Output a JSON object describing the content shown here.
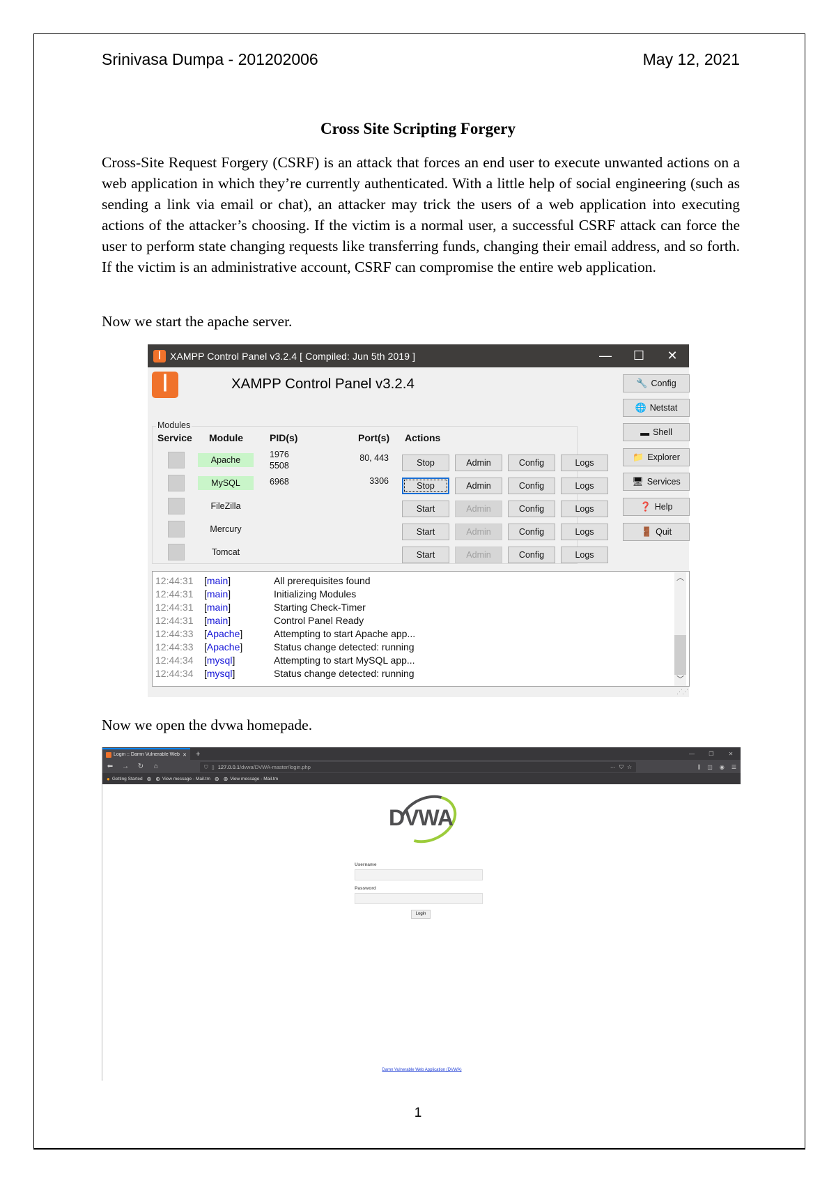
{
  "header": {
    "author": "Srinivasa Dumpa - 201202006",
    "date": "May 12, 2021"
  },
  "title": "Cross Site Scripting Forgery",
  "paragraphs": {
    "intro": "Cross-Site Request Forgery (CSRF) is an attack that forces an end user to execute unwanted actions on a web application in which they’re currently authenticated. With a little help of social engineering (such as sending a link via email or chat), an attacker may trick the users of a web application into executing actions of the attacker’s choosing. If the victim is a normal user, a successful CSRF attack can force the user to perform state changing requests like transferring funds, changing their email address, and so forth. If the victim is an administrative account, CSRF can compromise the entire web application.",
    "start_server": "Now we start the apache server.",
    "open_dvwa": "Now we open the dvwa homepade."
  },
  "page_number": "1",
  "xampp": {
    "window_title": "XAMPP Control Panel v3.2.4   [ Compiled: Jun 5th 2019 ]",
    "logo_glyph": "ꟾ",
    "heading": "XAMPP Control Panel v3.2.4",
    "modules_label": "Modules",
    "columns": {
      "service": "Service",
      "module": "Module",
      "pids": "PID(s)",
      "ports": "Port(s)",
      "actions": "Actions"
    },
    "modules": [
      {
        "name": "Apache",
        "running": true,
        "pids": [
          "1976",
          "5508"
        ],
        "ports": "80, 443",
        "action": "Stop",
        "admin": "Admin",
        "admin_enabled": true,
        "config": "Config",
        "logs": "Logs"
      },
      {
        "name": "MySQL",
        "running": true,
        "pids": [
          "6968"
        ],
        "ports": "3306",
        "action": "Stop",
        "admin": "Admin",
        "admin_enabled": true,
        "config": "Config",
        "logs": "Logs"
      },
      {
        "name": "FileZilla",
        "running": false,
        "pids": [],
        "ports": "",
        "action": "Start",
        "admin": "Admin",
        "admin_enabled": false,
        "config": "Config",
        "logs": "Logs"
      },
      {
        "name": "Mercury",
        "running": false,
        "pids": [],
        "ports": "",
        "action": "Start",
        "admin": "Admin",
        "admin_enabled": false,
        "config": "Config",
        "logs": "Logs"
      },
      {
        "name": "Tomcat",
        "running": false,
        "pids": [],
        "ports": "",
        "action": "Start",
        "admin": "Admin",
        "admin_enabled": false,
        "config": "Config",
        "logs": "Logs"
      }
    ],
    "side_buttons": [
      {
        "label": "Config",
        "icon": "wrench-icon",
        "glyph": "🔧"
      },
      {
        "label": "Netstat",
        "icon": "globe-icon",
        "glyph": "🌐"
      },
      {
        "label": "Shell",
        "icon": "terminal-icon",
        "glyph": "▬"
      },
      {
        "label": "Explorer",
        "icon": "folder-icon",
        "glyph": "📁"
      },
      {
        "label": "Services",
        "icon": "services-icon",
        "glyph": "🖥"
      },
      {
        "label": "Help",
        "icon": "help-icon",
        "glyph": "❓"
      },
      {
        "label": "Quit",
        "icon": "door-icon",
        "glyph": "🚪"
      }
    ],
    "log": [
      {
        "time": "12:44:31",
        "source": "main",
        "message": "All prerequisites found"
      },
      {
        "time": "12:44:31",
        "source": "main",
        "message": "Initializing Modules"
      },
      {
        "time": "12:44:31",
        "source": "main",
        "message": "Starting Check-Timer"
      },
      {
        "time": "12:44:31",
        "source": "main",
        "message": "Control Panel Ready"
      },
      {
        "time": "12:44:33",
        "source": "Apache",
        "message": "Attempting to start Apache app..."
      },
      {
        "time": "12:44:33",
        "source": "Apache",
        "message": "Status change detected: running"
      },
      {
        "time": "12:44:34",
        "source": "mysql",
        "message": "Attempting to start MySQL app..."
      },
      {
        "time": "12:44:34",
        "source": "mysql",
        "message": "Status change detected: running"
      }
    ]
  },
  "browser": {
    "tab_title": "Login :: Damn Vulnerable Web",
    "url_host": "127.0.0.1",
    "url_path": "/dvwa/DVWA-master/login.php",
    "bookmarks": [
      "Getting Started",
      "View message - Mail.tm",
      "View message - Mail.tm"
    ],
    "page": {
      "logo_text": "DVWA",
      "username_label": "Username",
      "username_value": "",
      "password_label": "Password",
      "password_value": "",
      "login_button": "Login",
      "footer_link": "Damn Vulnerable Web Application (DVWA)"
    }
  }
}
